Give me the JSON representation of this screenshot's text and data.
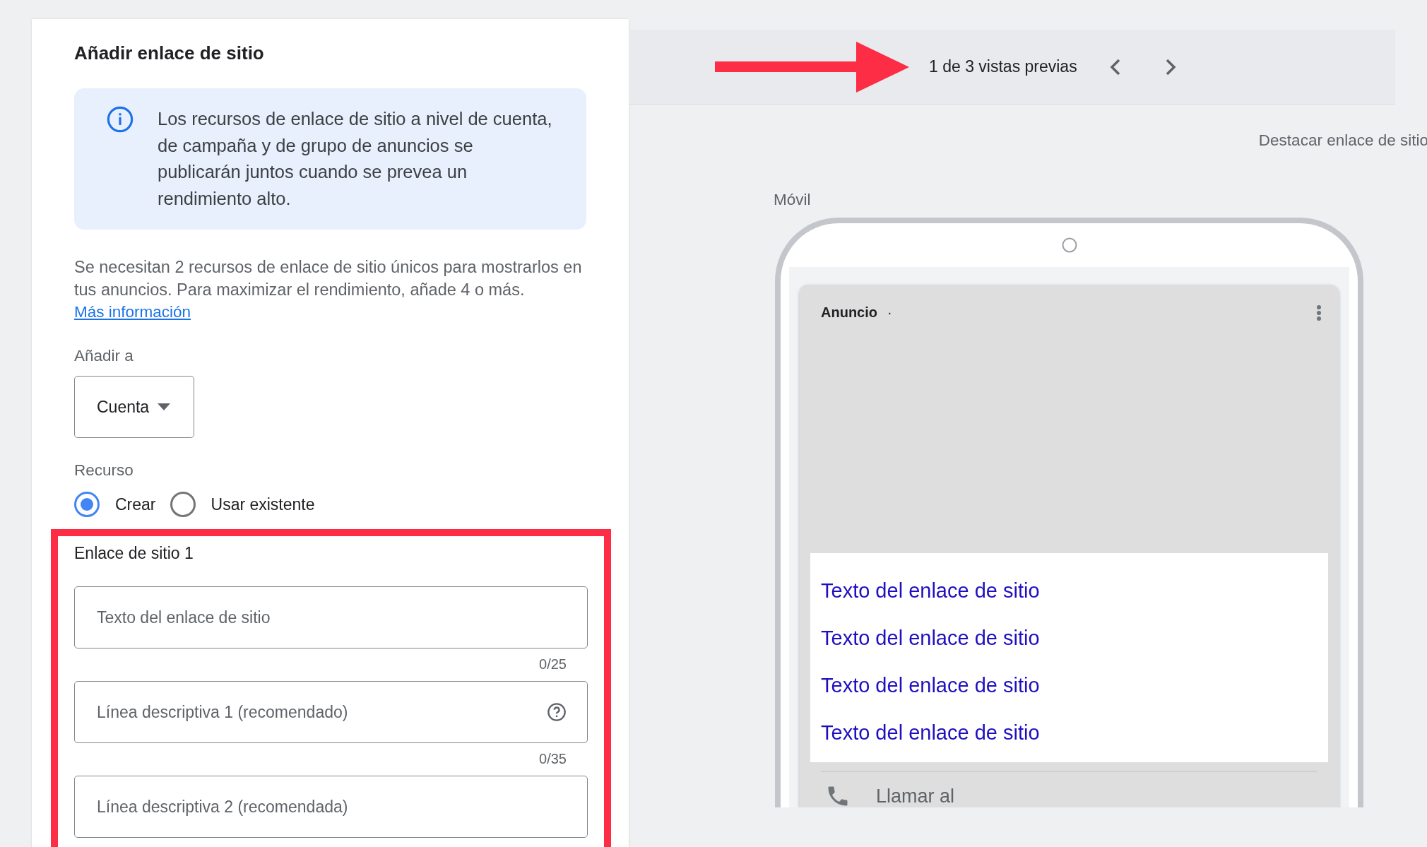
{
  "form": {
    "title": "Añadir enlace de sitio",
    "info": "Los recursos de enlace de sitio a nivel de cuenta, de campaña y de grupo de anuncios se publicarán juntos cuando se prevea un rendimiento alto.",
    "note": "Se necesitan 2 recursos de enlace de sitio únicos para mostrarlos en tus anuncios. Para maximizar el rendimiento, añade 4 o más.",
    "link": "Más información",
    "add_to": {
      "label": "Añadir a",
      "value": "Cuenta"
    },
    "resource": {
      "label": "Recurso",
      "options": [
        {
          "label": "Crear",
          "selected": true
        },
        {
          "label": "Usar existente",
          "selected": false
        }
      ]
    },
    "sitelink": {
      "title": "Enlace de sitio 1",
      "fields": [
        {
          "placeholder": "Texto del enlace de sitio",
          "counter": "0/25",
          "help": false
        },
        {
          "placeholder": "Línea descriptiva 1 (recomendado)",
          "counter": "0/35",
          "help": true
        },
        {
          "placeholder": "Línea descriptiva 2 (recomendada)",
          "help": false
        }
      ]
    }
  },
  "preview": {
    "pager": "1 de 3 vistas previas",
    "feature_label": "Destacar enlace de sitio",
    "device": "Móvil",
    "ad": {
      "label": "Anuncio",
      "separator": "·",
      "links": [
        "Texto del enlace de sitio",
        "Texto del enlace de sitio",
        "Texto del enlace de sitio",
        "Texto del enlace de sitio"
      ],
      "call": "Llamar al"
    }
  }
}
